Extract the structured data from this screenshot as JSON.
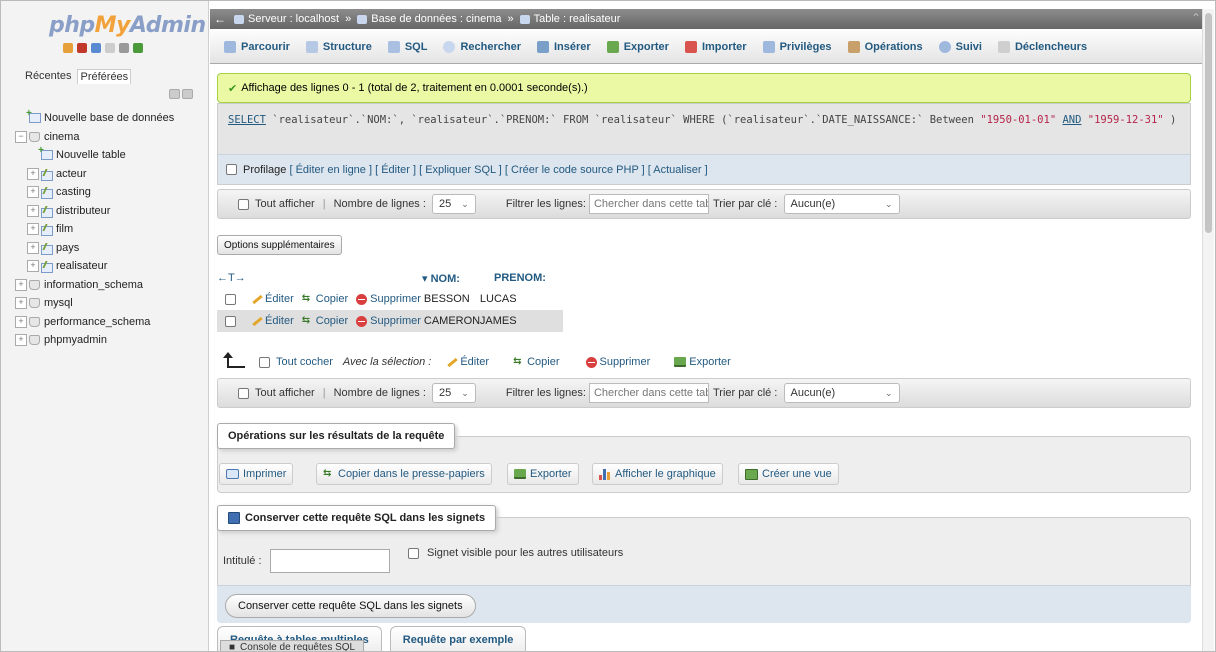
{
  "sidebar": {
    "logo_php": "php",
    "logo_my": "My",
    "logo_admin": "Admin",
    "tabs": [
      "Récentes",
      "Préférées"
    ],
    "tree": [
      {
        "label": "Nouvelle base de données",
        "type": "new-db",
        "level": 0
      },
      {
        "label": "cinema",
        "type": "db",
        "level": 0
      },
      {
        "label": "Nouvelle table",
        "type": "new-table",
        "level": 1
      },
      {
        "label": "acteur",
        "type": "table",
        "level": 1
      },
      {
        "label": "casting",
        "type": "table",
        "level": 1
      },
      {
        "label": "distributeur",
        "type": "table",
        "level": 1
      },
      {
        "label": "film",
        "type": "table",
        "level": 1
      },
      {
        "label": "pays",
        "type": "table",
        "level": 1
      },
      {
        "label": "realisateur",
        "type": "table",
        "level": 1
      },
      {
        "label": "information_schema",
        "type": "db",
        "level": 0
      },
      {
        "label": "mysql",
        "type": "db",
        "level": 0
      },
      {
        "label": "performance_schema",
        "type": "db",
        "level": 0
      },
      {
        "label": "phpmyadmin",
        "type": "db",
        "level": 0
      }
    ]
  },
  "breadcrumb": {
    "server": "Serveur : localhost",
    "database": "Base de données : cinema",
    "table": "Table : realisateur",
    "separator": "»"
  },
  "tabs": [
    "Parcourir",
    "Structure",
    "SQL",
    "Rechercher",
    "Insérer",
    "Exporter",
    "Importer",
    "Privilèges",
    "Opérations",
    "Suivi",
    "Déclencheurs"
  ],
  "success": "Affichage des lignes 0 - 1 (total de 2, traitement en 0.0001 seconde(s).)",
  "sql": {
    "select": "SELECT",
    "part1": " `realisateur`.`NOM:`, `realisateur`.`PRENOM:` FROM `realisateur` WHERE (`realisateur`.`DATE_NAISSANCE:` Between ",
    "str1": "\"1950-01-01\"",
    "and": "AND",
    "str2": "\"1959-12-31\"",
    "part2": " )"
  },
  "profiling": {
    "label": "Profilage",
    "links": "[ Éditer en ligne ] [ Éditer ] [ Expliquer SQL ] [ Créer le code source PHP ] [ Actualiser ]"
  },
  "nav": {
    "show_all": "Tout afficher",
    "rows_label": "Nombre de lignes :",
    "rows_value": "25",
    "filter_label": "Filtrer les lignes:",
    "filter_placeholder": "Chercher dans cette table",
    "sort_label": "Trier par clé :",
    "sort_value": "Aucun(e)"
  },
  "more_options": "Options supplémentaires",
  "results": {
    "sort_arrows": "←T→",
    "columns": [
      "NOM:",
      "PRENOM:"
    ],
    "edit": "Éditer",
    "copy": "Copier",
    "delete": "Supprimer",
    "rows": [
      {
        "nom": "BESSON",
        "prenom": "LUCAS"
      },
      {
        "nom": "CAMERON",
        "prenom": "JAMES"
      }
    ]
  },
  "with_selection": {
    "check_all": "Tout cocher",
    "label": "Avec la sélection :",
    "edit": "Éditer",
    "copy": "Copier",
    "delete": "Supprimer",
    "export": "Exporter"
  },
  "operations": {
    "legend": "Opérations sur les résultats de la requête",
    "print": "Imprimer",
    "copy_clipboard": "Copier dans le presse-papiers",
    "export": "Exporter",
    "chart": "Afficher le graphique",
    "view": "Créer une vue"
  },
  "bookmark": {
    "legend": "Conserver cette requête SQL dans les signets",
    "label_field": "Intitulé :",
    "visible": "Signet visible pour les autres utilisateurs",
    "button": "Conserver cette requête SQL dans les signets"
  },
  "bottom_tabs": [
    "Requête à tables multiples",
    "Requête par exemple"
  ],
  "console": "Console de requêtes SQL"
}
